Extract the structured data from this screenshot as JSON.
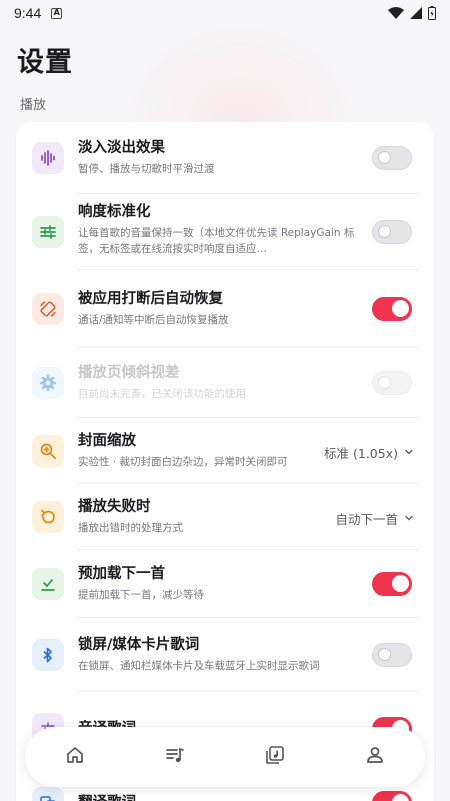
{
  "status_bar": {
    "time": "9:44",
    "badge": "A"
  },
  "page": {
    "title": "设置",
    "section": "播放"
  },
  "colors": {
    "accent": "#f0334e",
    "toggle_off": "#e5e4e8"
  },
  "settings": [
    {
      "title": "淡入淡出效果",
      "subtitle": "暂停、播放与切歌时平滑过渡",
      "control": "toggle",
      "on": false,
      "icon": "waveform-icon",
      "icon_color": "#8e4fc9",
      "icon_bg": "#f1e9fa"
    },
    {
      "title": "响度标准化",
      "subtitle": "让每首歌的音量保持一致（本地文件优先读 ReplayGain 标签，无标签或在线流按实时响度自适应…",
      "control": "toggle",
      "on": false,
      "icon": "sliders-icon",
      "icon_color": "#2f9a4a",
      "icon_bg": "#e6f4ea"
    },
    {
      "title": "被应用打断后自动恢复",
      "subtitle": "通话/通知等中断后自动恢复播放",
      "control": "toggle",
      "on": true,
      "icon": "rotate-icon",
      "icon_color": "#e0592a",
      "icon_bg": "#fdeae2"
    },
    {
      "title": "播放页倾斜视差",
      "subtitle": "目前尚未完善，已关闭该功能的使用",
      "control": "toggle",
      "on": false,
      "disabled": true,
      "icon": "gear-icon",
      "icon_color": "#9fc8ec",
      "icon_bg": "#f2f7fc"
    },
    {
      "title": "封面缩放",
      "subtitle": "实验性 · 裁切封面白边杂边，异常时关闭即可",
      "control": "select",
      "value": "标准 (1.05x)",
      "icon": "zoom-icon",
      "icon_color": "#d98a12",
      "icon_bg": "#fdf1dc"
    },
    {
      "title": "播放失败时",
      "subtitle": "播放出错时的处理方式",
      "control": "select",
      "value": "自动下一首",
      "icon": "undo-icon",
      "icon_color": "#d98a12",
      "icon_bg": "#fdf1dc"
    },
    {
      "title": "预加载下一首",
      "subtitle": "提前加载下一首，减少等待",
      "control": "toggle",
      "on": true,
      "icon": "download-check-icon",
      "icon_color": "#2f9a4a",
      "icon_bg": "#e6f4ea"
    },
    {
      "title": "锁屏/媒体卡片歌词",
      "subtitle": "在锁屏、通知栏媒体卡片及车载蓝牙上实时显示歌词",
      "control": "toggle",
      "on": false,
      "icon": "bluetooth-icon",
      "icon_color": "#2a6fd6",
      "icon_bg": "#e6effc"
    },
    {
      "title": "音译歌词",
      "subtitle": "",
      "control": "toggle",
      "on": true,
      "icon": "language-icon",
      "icon_color": "#8e4fc9",
      "icon_bg": "#f1e9fa"
    },
    {
      "title": "翻译歌词",
      "subtitle": "",
      "control": "toggle",
      "on": true,
      "icon": "translate-icon",
      "icon_color": "#2a6fd6",
      "icon_bg": "#e6effc"
    }
  ],
  "bottom_nav": [
    {
      "icon": "home-icon"
    },
    {
      "icon": "playlist-icon"
    },
    {
      "icon": "library-icon"
    },
    {
      "icon": "person-icon"
    }
  ]
}
